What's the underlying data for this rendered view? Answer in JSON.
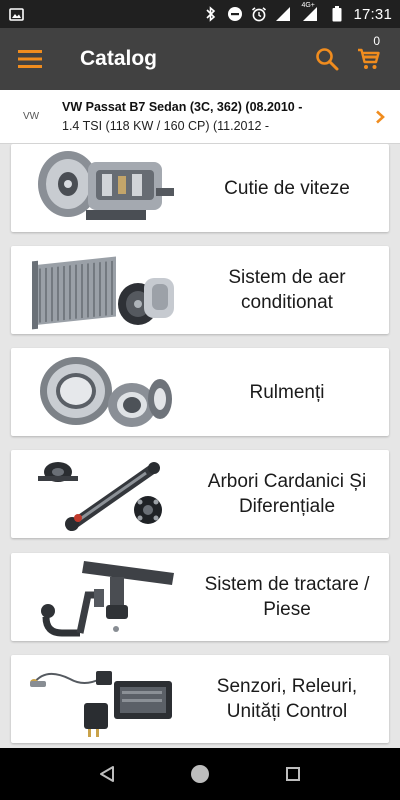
{
  "status_bar": {
    "network": "4G+",
    "time": "17:31",
    "icons": [
      "image-icon",
      "bluetooth-icon",
      "do-not-disturb-icon",
      "alarm-icon",
      "wifi-signal-icon",
      "cell-signal-icon",
      "battery-icon"
    ]
  },
  "app_bar": {
    "title": "Catalog",
    "cart_count": "0",
    "accent_color": "#f08c1e"
  },
  "vehicle": {
    "badge": "VW",
    "line1": "VW Passat B7 Sedan (3C, 362) (08.2010 -",
    "line2": "1.4 TSI (118 KW / 160 CP) (11.2012 -"
  },
  "categories": [
    {
      "label": "Cutie de viteze",
      "icon": "gearbox-icon"
    },
    {
      "label": "Sistem de aer conditionat",
      "icon": "air-conditioning-icon"
    },
    {
      "label": "Rulmenți",
      "icon": "bearings-icon"
    },
    {
      "label": "Arbori Cardanici Și Diferențiale",
      "icon": "driveshaft-icon"
    },
    {
      "label": "Sistem de tractare / Piese",
      "icon": "tow-bar-icon"
    },
    {
      "label": "Senzori, Releuri, Unități Control",
      "icon": "sensors-relays-icon"
    }
  ]
}
